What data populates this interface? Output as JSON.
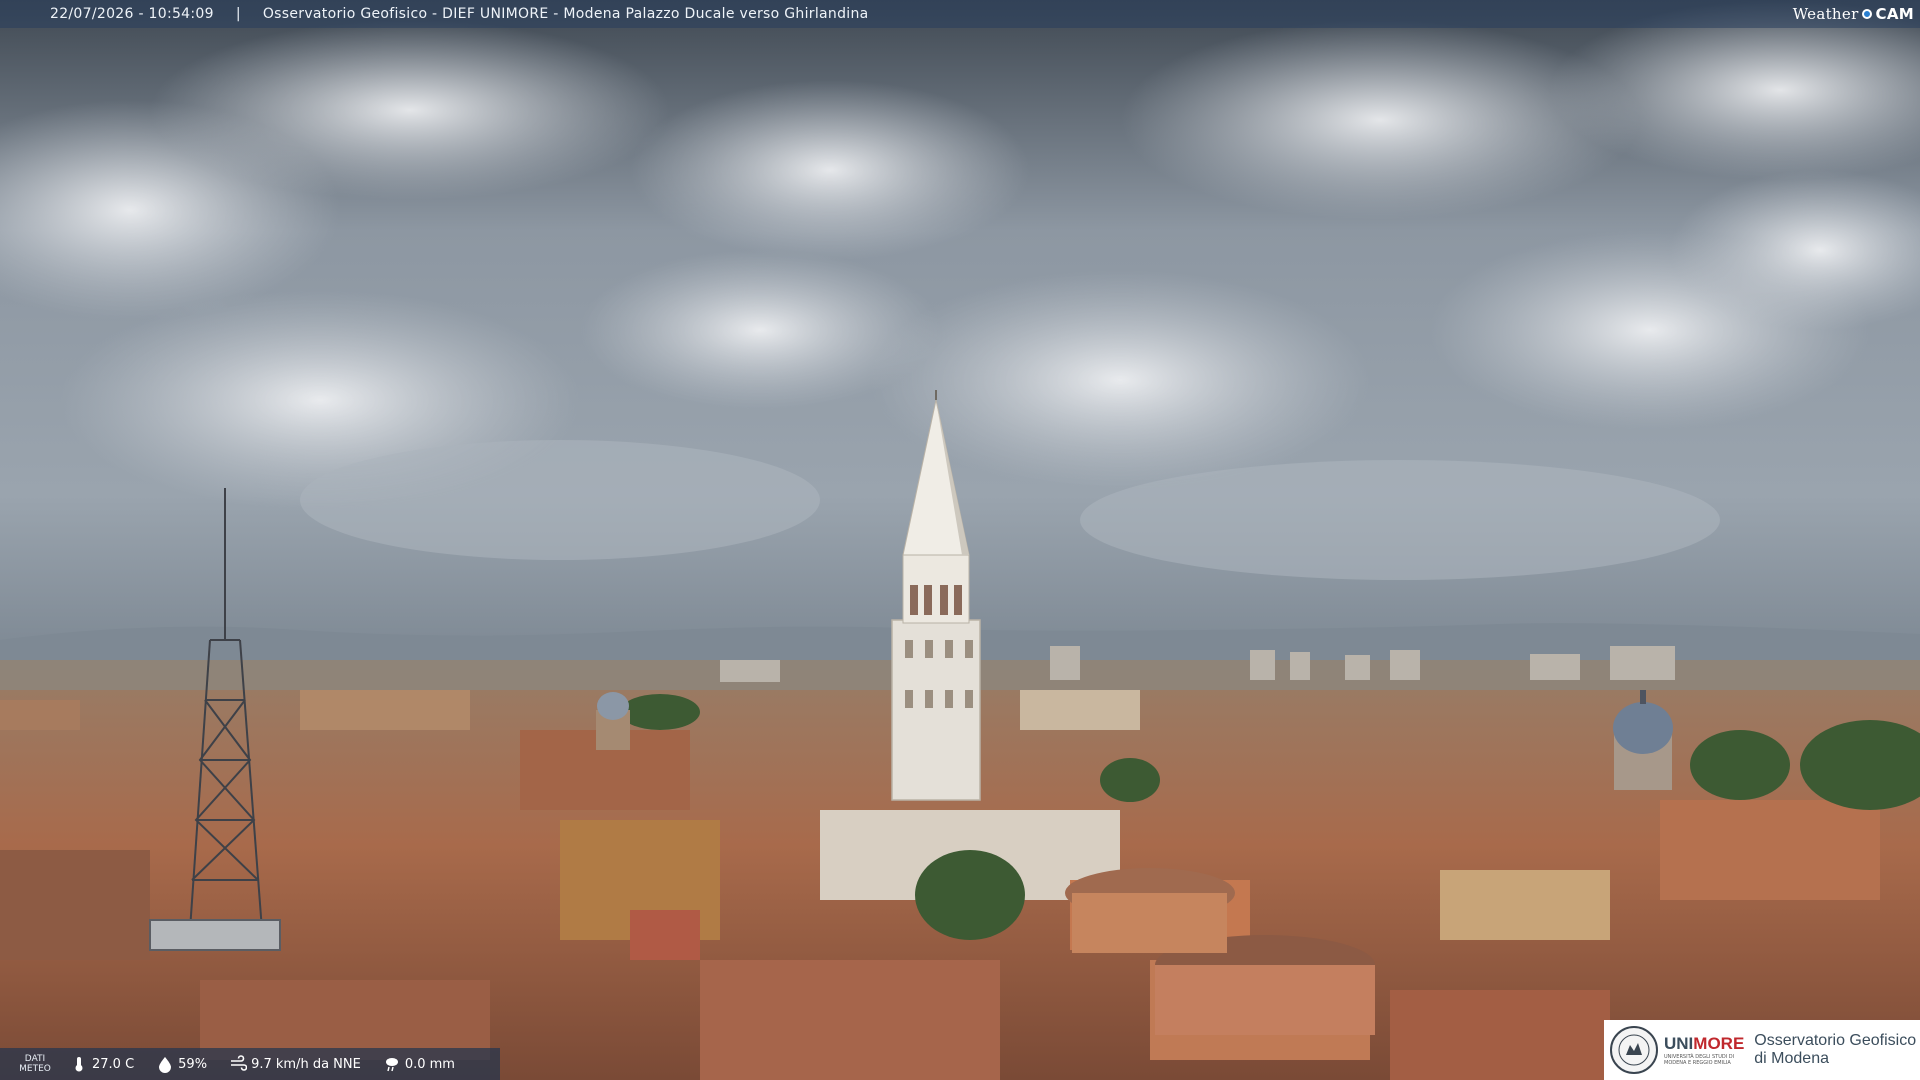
{
  "caption": {
    "datetime": "22/07/2026 - 10:54:09",
    "separator": "|",
    "title": "Osservatorio Geofisico - DIEF UNIMORE - Modena Palazzo Ducale verso Ghirlandina"
  },
  "brand": {
    "weather": "Weather",
    "cam": "CAM"
  },
  "weather_strip": {
    "dati_label_1": "DATI",
    "dati_label_2": "METEO",
    "temperature": "27.0 C",
    "humidity": "59%",
    "wind": "9.7 km/h da NNE",
    "rain": "0.0 mm",
    "icons": [
      "thermometer-icon",
      "humidity-drop-icon",
      "wind-icon",
      "rain-cloud-icon"
    ]
  },
  "logo": {
    "uni_name_1": "UNI",
    "uni_name_2": "MORE",
    "uni_sub": "UNIVERSITÀ DEGLI STUDI DI MODENA E REGGIO EMILIA",
    "obs_line_1": "Osservatorio Geofisico",
    "obs_line_2": "di Modena"
  },
  "colors": {
    "sky": "#8c97a3",
    "roof": "#a9694a",
    "tower": "#e7e3dc",
    "accent_red": "#c0282d"
  }
}
